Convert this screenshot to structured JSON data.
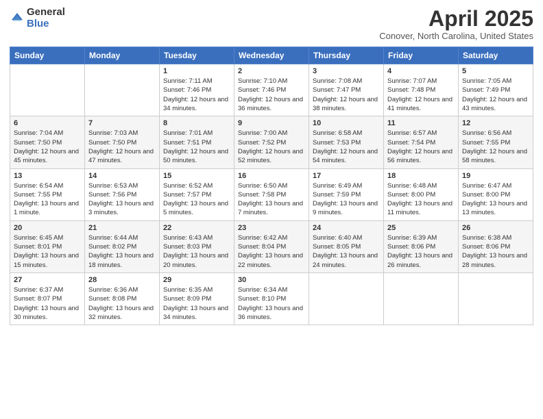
{
  "logo": {
    "general": "General",
    "blue": "Blue"
  },
  "title": {
    "month": "April 2025",
    "location": "Conover, North Carolina, United States"
  },
  "weekdays": [
    "Sunday",
    "Monday",
    "Tuesday",
    "Wednesday",
    "Thursday",
    "Friday",
    "Saturday"
  ],
  "weeks": [
    [
      {
        "day": "",
        "sunrise": "",
        "sunset": "",
        "daylight": ""
      },
      {
        "day": "",
        "sunrise": "",
        "sunset": "",
        "daylight": ""
      },
      {
        "day": "1",
        "sunrise": "Sunrise: 7:11 AM",
        "sunset": "Sunset: 7:46 PM",
        "daylight": "Daylight: 12 hours and 34 minutes."
      },
      {
        "day": "2",
        "sunrise": "Sunrise: 7:10 AM",
        "sunset": "Sunset: 7:46 PM",
        "daylight": "Daylight: 12 hours and 36 minutes."
      },
      {
        "day": "3",
        "sunrise": "Sunrise: 7:08 AM",
        "sunset": "Sunset: 7:47 PM",
        "daylight": "Daylight: 12 hours and 38 minutes."
      },
      {
        "day": "4",
        "sunrise": "Sunrise: 7:07 AM",
        "sunset": "Sunset: 7:48 PM",
        "daylight": "Daylight: 12 hours and 41 minutes."
      },
      {
        "day": "5",
        "sunrise": "Sunrise: 7:05 AM",
        "sunset": "Sunset: 7:49 PM",
        "daylight": "Daylight: 12 hours and 43 minutes."
      }
    ],
    [
      {
        "day": "6",
        "sunrise": "Sunrise: 7:04 AM",
        "sunset": "Sunset: 7:50 PM",
        "daylight": "Daylight: 12 hours and 45 minutes."
      },
      {
        "day": "7",
        "sunrise": "Sunrise: 7:03 AM",
        "sunset": "Sunset: 7:50 PM",
        "daylight": "Daylight: 12 hours and 47 minutes."
      },
      {
        "day": "8",
        "sunrise": "Sunrise: 7:01 AM",
        "sunset": "Sunset: 7:51 PM",
        "daylight": "Daylight: 12 hours and 50 minutes."
      },
      {
        "day": "9",
        "sunrise": "Sunrise: 7:00 AM",
        "sunset": "Sunset: 7:52 PM",
        "daylight": "Daylight: 12 hours and 52 minutes."
      },
      {
        "day": "10",
        "sunrise": "Sunrise: 6:58 AM",
        "sunset": "Sunset: 7:53 PM",
        "daylight": "Daylight: 12 hours and 54 minutes."
      },
      {
        "day": "11",
        "sunrise": "Sunrise: 6:57 AM",
        "sunset": "Sunset: 7:54 PM",
        "daylight": "Daylight: 12 hours and 56 minutes."
      },
      {
        "day": "12",
        "sunrise": "Sunrise: 6:56 AM",
        "sunset": "Sunset: 7:55 PM",
        "daylight": "Daylight: 12 hours and 58 minutes."
      }
    ],
    [
      {
        "day": "13",
        "sunrise": "Sunrise: 6:54 AM",
        "sunset": "Sunset: 7:55 PM",
        "daylight": "Daylight: 13 hours and 1 minute."
      },
      {
        "day": "14",
        "sunrise": "Sunrise: 6:53 AM",
        "sunset": "Sunset: 7:56 PM",
        "daylight": "Daylight: 13 hours and 3 minutes."
      },
      {
        "day": "15",
        "sunrise": "Sunrise: 6:52 AM",
        "sunset": "Sunset: 7:57 PM",
        "daylight": "Daylight: 13 hours and 5 minutes."
      },
      {
        "day": "16",
        "sunrise": "Sunrise: 6:50 AM",
        "sunset": "Sunset: 7:58 PM",
        "daylight": "Daylight: 13 hours and 7 minutes."
      },
      {
        "day": "17",
        "sunrise": "Sunrise: 6:49 AM",
        "sunset": "Sunset: 7:59 PM",
        "daylight": "Daylight: 13 hours and 9 minutes."
      },
      {
        "day": "18",
        "sunrise": "Sunrise: 6:48 AM",
        "sunset": "Sunset: 8:00 PM",
        "daylight": "Daylight: 13 hours and 11 minutes."
      },
      {
        "day": "19",
        "sunrise": "Sunrise: 6:47 AM",
        "sunset": "Sunset: 8:00 PM",
        "daylight": "Daylight: 13 hours and 13 minutes."
      }
    ],
    [
      {
        "day": "20",
        "sunrise": "Sunrise: 6:45 AM",
        "sunset": "Sunset: 8:01 PM",
        "daylight": "Daylight: 13 hours and 15 minutes."
      },
      {
        "day": "21",
        "sunrise": "Sunrise: 6:44 AM",
        "sunset": "Sunset: 8:02 PM",
        "daylight": "Daylight: 13 hours and 18 minutes."
      },
      {
        "day": "22",
        "sunrise": "Sunrise: 6:43 AM",
        "sunset": "Sunset: 8:03 PM",
        "daylight": "Daylight: 13 hours and 20 minutes."
      },
      {
        "day": "23",
        "sunrise": "Sunrise: 6:42 AM",
        "sunset": "Sunset: 8:04 PM",
        "daylight": "Daylight: 13 hours and 22 minutes."
      },
      {
        "day": "24",
        "sunrise": "Sunrise: 6:40 AM",
        "sunset": "Sunset: 8:05 PM",
        "daylight": "Daylight: 13 hours and 24 minutes."
      },
      {
        "day": "25",
        "sunrise": "Sunrise: 6:39 AM",
        "sunset": "Sunset: 8:06 PM",
        "daylight": "Daylight: 13 hours and 26 minutes."
      },
      {
        "day": "26",
        "sunrise": "Sunrise: 6:38 AM",
        "sunset": "Sunset: 8:06 PM",
        "daylight": "Daylight: 13 hours and 28 minutes."
      }
    ],
    [
      {
        "day": "27",
        "sunrise": "Sunrise: 6:37 AM",
        "sunset": "Sunset: 8:07 PM",
        "daylight": "Daylight: 13 hours and 30 minutes."
      },
      {
        "day": "28",
        "sunrise": "Sunrise: 6:36 AM",
        "sunset": "Sunset: 8:08 PM",
        "daylight": "Daylight: 13 hours and 32 minutes."
      },
      {
        "day": "29",
        "sunrise": "Sunrise: 6:35 AM",
        "sunset": "Sunset: 8:09 PM",
        "daylight": "Daylight: 13 hours and 34 minutes."
      },
      {
        "day": "30",
        "sunrise": "Sunrise: 6:34 AM",
        "sunset": "Sunset: 8:10 PM",
        "daylight": "Daylight: 13 hours and 36 minutes."
      },
      {
        "day": "",
        "sunrise": "",
        "sunset": "",
        "daylight": ""
      },
      {
        "day": "",
        "sunrise": "",
        "sunset": "",
        "daylight": ""
      },
      {
        "day": "",
        "sunrise": "",
        "sunset": "",
        "daylight": ""
      }
    ]
  ]
}
